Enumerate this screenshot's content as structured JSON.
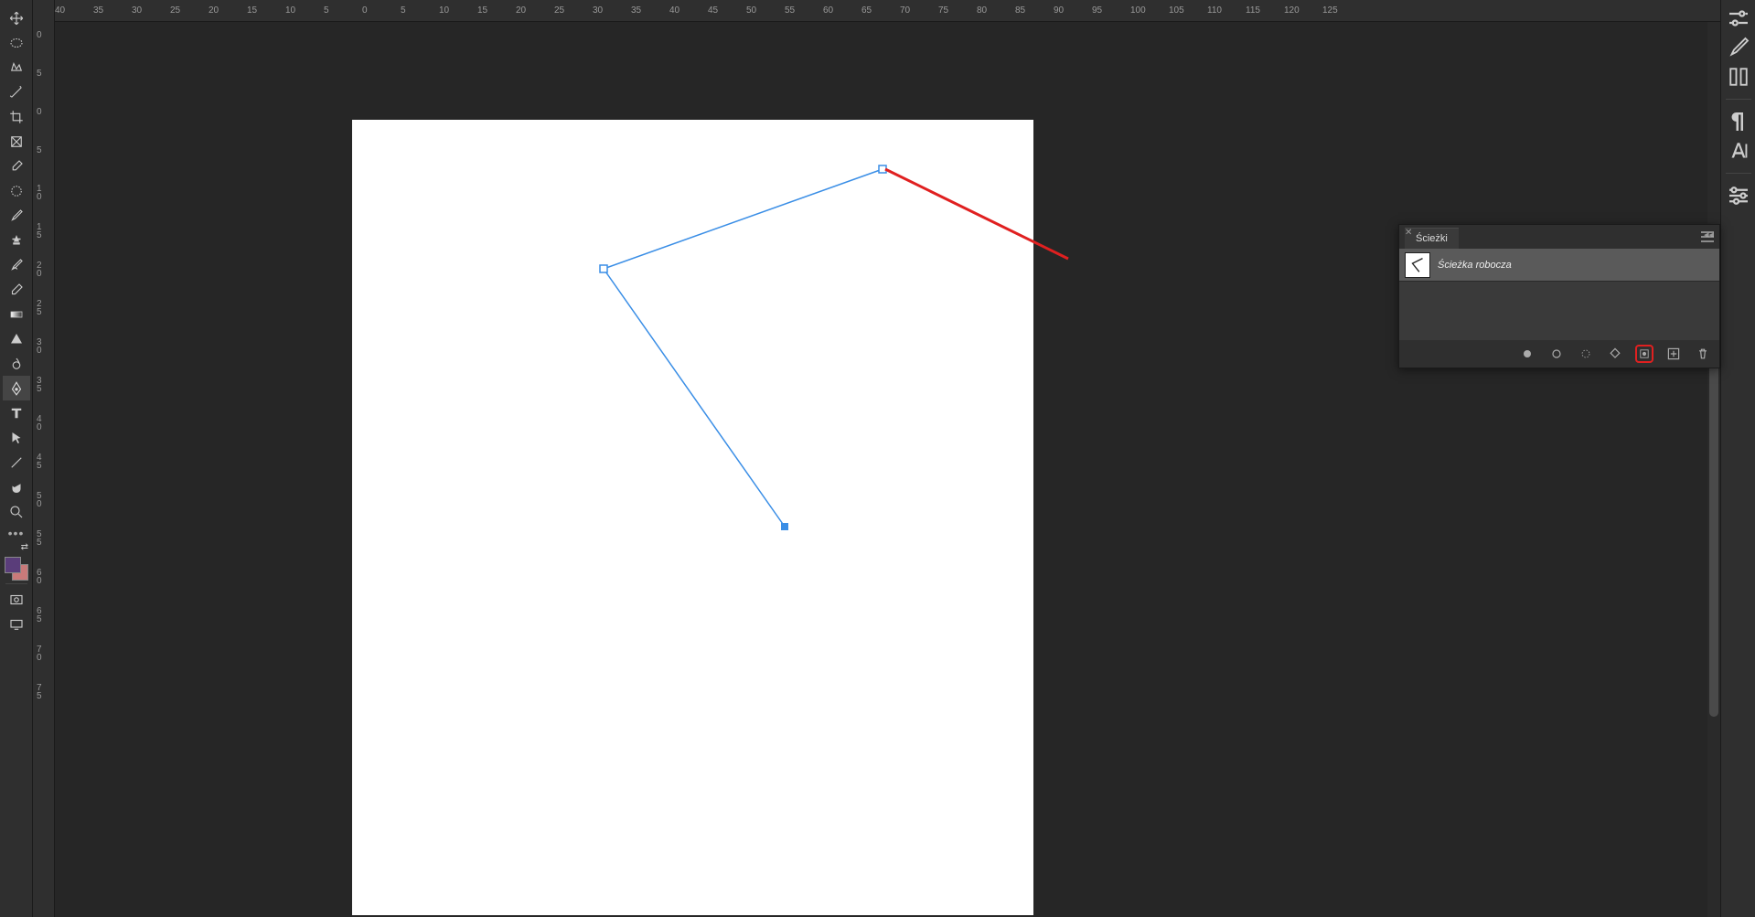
{
  "ruler_h": [
    "40",
    "35",
    "30",
    "25",
    "20",
    "15",
    "10",
    "5",
    "0",
    "5",
    "10",
    "15",
    "20",
    "25",
    "30",
    "35",
    "40",
    "45",
    "50",
    "55",
    "60",
    "65",
    "70",
    "75",
    "80",
    "85",
    "90",
    "95",
    "100",
    "105",
    "110",
    "115",
    "120",
    "125"
  ],
  "ruler_v": [
    "0",
    "5",
    "0",
    "5",
    "10",
    "15",
    "20",
    "25",
    "30",
    "35",
    "40",
    "45",
    "50",
    "55",
    "60",
    "65",
    "70",
    "75"
  ],
  "tools": {
    "move": "move-tool",
    "ellipse": "ellipse-marquee-tool",
    "lasso": "lasso-tool",
    "wand": "magic-wand-tool",
    "crop": "crop-tool",
    "frame": "frame-tool",
    "eyedropper": "eyedropper-tool",
    "heal": "healing-brush-tool",
    "brush": "brush-tool",
    "stamp": "clone-stamp-tool",
    "history": "history-brush-tool",
    "eraser": "eraser-tool",
    "gradient": "gradient-tool",
    "shape": "shape-tool",
    "blur": "blur-tool",
    "pen": "pen-tool",
    "type": "type-tool",
    "path_select": "path-selection-tool",
    "line": "line-tool",
    "hand": "hand-tool",
    "zoom": "zoom-tool"
  },
  "panel": {
    "tab_label": "Ścieżki",
    "path_label": "Ścieżka robocza"
  },
  "colors": {
    "fg": "#5a3d7a",
    "bg": "#c97a7a",
    "path": "#3a8ee6",
    "annotation": "#e02020"
  }
}
